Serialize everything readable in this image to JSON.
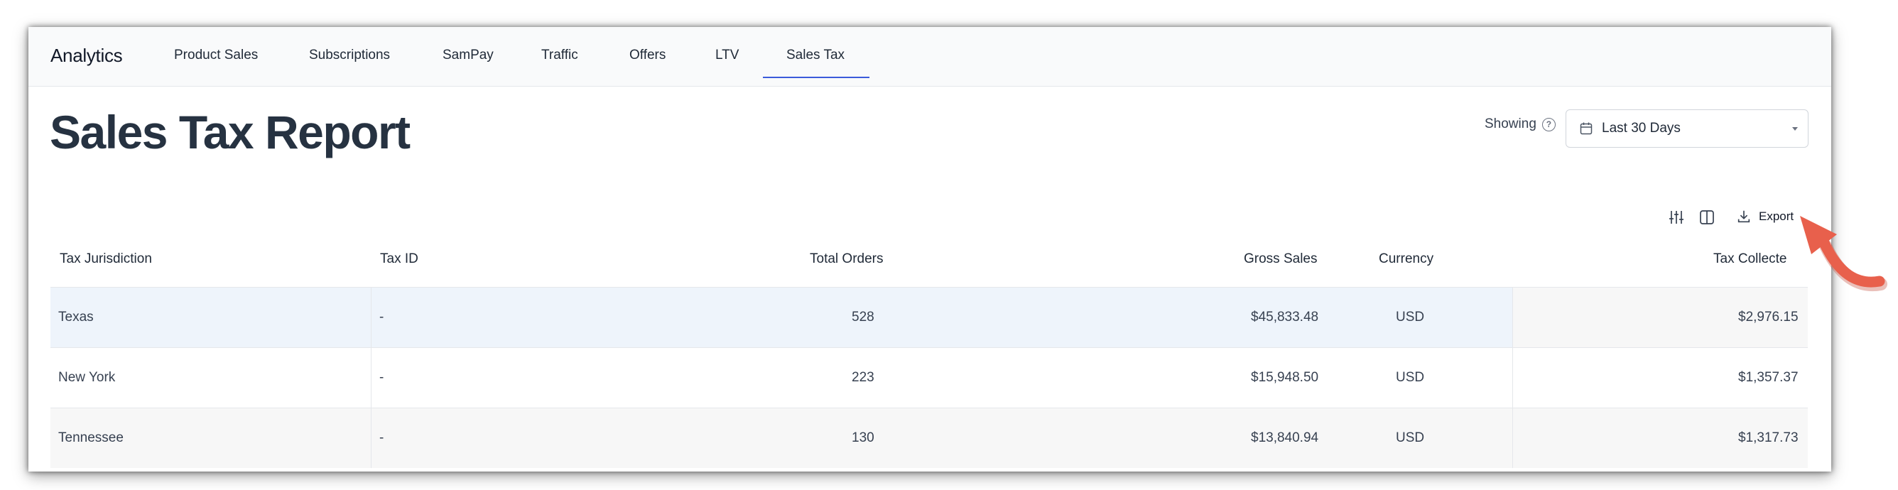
{
  "app": {
    "brand": "Analytics"
  },
  "nav": {
    "items": [
      {
        "label": "Product Sales"
      },
      {
        "label": "Subscriptions"
      },
      {
        "label": "SamPay"
      },
      {
        "label": "Traffic"
      },
      {
        "label": "Offers"
      },
      {
        "label": "LTV"
      },
      {
        "label": "Sales Tax"
      }
    ],
    "active_index": 6
  },
  "page": {
    "title": "Sales Tax Report"
  },
  "filter": {
    "showing_label": "Showing",
    "date_range": "Last 30 Days"
  },
  "toolbar": {
    "export_label": "Export"
  },
  "table": {
    "columns": [
      "Tax Jurisdiction",
      "Tax ID",
      "Total Orders",
      "Gross Sales",
      "Currency",
      "Tax Collecte"
    ],
    "rows": [
      {
        "jurisdiction": "Texas",
        "tax_id": "-",
        "orders": "528",
        "gross": "$45,833.48",
        "currency": "USD",
        "tax": "$2,976.15"
      },
      {
        "jurisdiction": "New York",
        "tax_id": "-",
        "orders": "223",
        "gross": "$15,948.50",
        "currency": "USD",
        "tax": "$1,357.37"
      },
      {
        "jurisdiction": "Tennessee",
        "tax_id": "-",
        "orders": "130",
        "gross": "$13,840.94",
        "currency": "USD",
        "tax": "$1,317.73"
      }
    ],
    "row_colors": [
      "#eef4fb",
      "#ffffff",
      "#f7f7f7"
    ],
    "right_part_colors": [
      "#f7f7f7",
      "#ffffff",
      "#f7f7f7"
    ]
  },
  "colors": {
    "accent": "#3b5bdb",
    "annotation_arrow": "#e8604c"
  },
  "icons": [
    "calendar-icon",
    "help-circle-icon",
    "filter-sliders-icon",
    "columns-icon",
    "download-icon",
    "annotation-arrow"
  ]
}
